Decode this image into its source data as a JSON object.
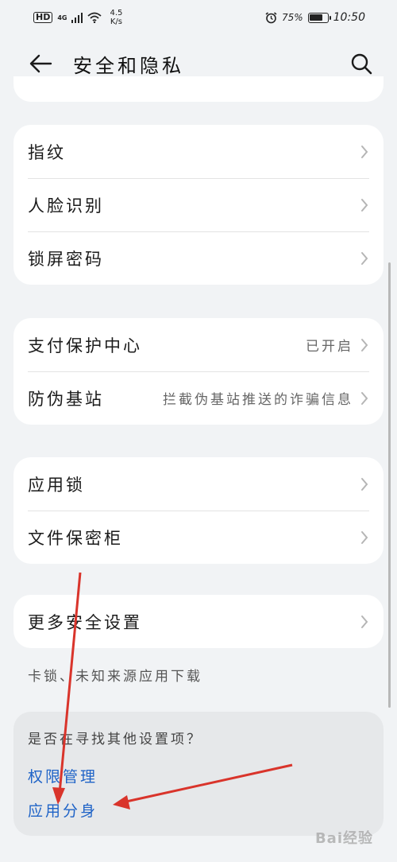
{
  "status_bar": {
    "network_hd": "HD",
    "network_4g": "4G",
    "speed_value": "4.5",
    "speed_unit": "K/s",
    "battery_percent": "75%",
    "battery_level": 0.75,
    "time": "10:50"
  },
  "header": {
    "title": "安全和隐私"
  },
  "groups": [
    {
      "items": [
        {
          "label": "指纹",
          "value": ""
        },
        {
          "label": "人脸识别",
          "value": ""
        },
        {
          "label": "锁屏密码",
          "value": ""
        }
      ]
    },
    {
      "items": [
        {
          "label": "支付保护中心",
          "value": "已开启"
        },
        {
          "label": "防伪基站",
          "value": "拦截伪基站推送的诈骗信息"
        }
      ]
    },
    {
      "items": [
        {
          "label": "应用锁",
          "value": ""
        },
        {
          "label": "文件保密柜",
          "value": ""
        }
      ]
    },
    {
      "items": [
        {
          "label": "更多安全设置",
          "value": ""
        }
      ]
    }
  ],
  "more_note": "卡锁、未知来源应用下载",
  "suggestions": {
    "title": "是否在寻找其他设置项？",
    "links": [
      "权限管理",
      "应用分身"
    ]
  },
  "colors": {
    "accent": "#1f63c7",
    "annotation_arrow": "#d9342b"
  },
  "watermark": "Bai经验"
}
